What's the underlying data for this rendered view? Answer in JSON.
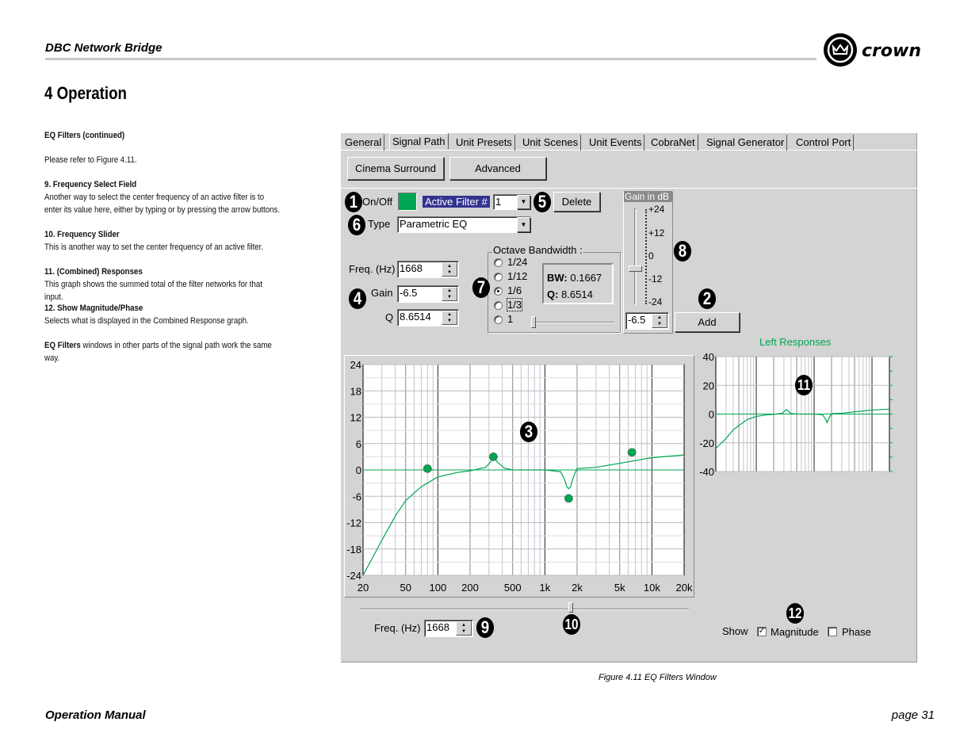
{
  "header": {
    "title": "DBC Network Bridge",
    "logo_text": "crown",
    "section": "4 Operation"
  },
  "body": {
    "heading": "EQ Filters (continued)",
    "refer": "Please refer to Figure 4.11.",
    "items": [
      {
        "title": "9. Frequency Select Field",
        "text": "Another way to select the center frequency of an active filter is to enter its value here, either by typing or by pressing the arrow buttons."
      },
      {
        "title": "10. Frequency Slider",
        "text": "This is another way to set the center frequency of an active filter."
      },
      {
        "title": "11. (Combined) Responses",
        "text": "This graph shows the summed total of the filter networks for that input."
      },
      {
        "title": "12. Show Magnitude/Phase",
        "text": "Selects what is displayed in the Combined Response graph."
      }
    ],
    "closing_bold": "EQ Filters",
    "closing_rest": " windows in other parts of the signal path work the same way."
  },
  "window": {
    "tabs": [
      "General",
      "Signal Path",
      "Unit Presets",
      "Unit Scenes",
      "Unit Events",
      "CobraNet",
      "Signal Generator",
      "Control Port"
    ],
    "selected_tab": "Signal Path",
    "buttons": {
      "cinema": "Cinema Surround",
      "advanced": "Advanced",
      "delete": "Delete",
      "add": "Add"
    },
    "onoff_label": "On/Off",
    "onoff_color": "#00a651",
    "active_filter_label": "Active Filter #",
    "active_filter_value": "1",
    "type_label": "Type",
    "type_value": "Parametric EQ",
    "freq_label": "Freq. (Hz)",
    "freq_value": "1668",
    "gain_label": "Gain",
    "gain_value": "-6.5",
    "q_label": "Q",
    "q_value": "8.6514",
    "octave": {
      "title": "Octave Bandwidth :",
      "options": [
        "1/24",
        "1/12",
        "1/6",
        "1/3",
        "1"
      ],
      "selected": "1/6",
      "bw_label": "BW:",
      "bw_value": "0.1667",
      "q_label": "Q:",
      "q_value": "8.6514"
    },
    "gain_slider": {
      "title": "Gain in dB",
      "ticks": [
        "+24",
        "+12",
        "0",
        "-12",
        "-24"
      ],
      "value": "-6.5"
    },
    "bottom_freq_label": "Freq. (Hz)",
    "bottom_freq_value": "1668",
    "show_label": "Show",
    "magnitude_label": "Magnitude",
    "magnitude_checked": true,
    "phase_label": "Phase",
    "phase_checked": false,
    "callouts": [
      "1",
      "2",
      "3",
      "4",
      "5",
      "6",
      "7",
      "8",
      "9",
      "10",
      "11",
      "12"
    ]
  },
  "chart_data": [
    {
      "type": "line",
      "title": "",
      "xscale": "log",
      "xlim": [
        20,
        20000
      ],
      "ylim": [
        -24,
        24
      ],
      "xticks": [
        "20",
        "50",
        "100",
        "200",
        "500",
        "1k",
        "2k",
        "5k",
        "10k",
        "20k"
      ],
      "xtick_values": [
        20,
        50,
        100,
        200,
        500,
        1000,
        2000,
        5000,
        10000,
        20000
      ],
      "yticks": [
        "24",
        "18",
        "12",
        "6",
        "0",
        "-6",
        "-12",
        "-18",
        "-24"
      ],
      "grid": true,
      "color": "#00a651",
      "series": [
        {
          "x": [
            20,
            30,
            40,
            50,
            70,
            100,
            150,
            200,
            280,
            310,
            330,
            360,
            420,
            500,
            1000,
            1400,
            1520,
            1600,
            1668,
            1740,
            1850,
            2000,
            3000,
            5000,
            10000,
            20000
          ],
          "y": [
            -24,
            -16,
            -10.5,
            -7,
            -3.8,
            -1.6,
            -0.6,
            -0.2,
            0.6,
            1.8,
            3,
            1.8,
            0.4,
            0,
            0,
            -0.4,
            -2,
            -3.8,
            -4.3,
            -3.8,
            -1.5,
            0.3,
            0.6,
            1.5,
            2.8,
            3.4
          ]
        }
      ],
      "markers": [
        {
          "x": 80,
          "y": 0.3
        },
        {
          "x": 330,
          "y": 3
        },
        {
          "x": 1668,
          "y": -6.5
        },
        {
          "x": 6500,
          "y": 4
        }
      ]
    },
    {
      "type": "line",
      "title": "Left Responses",
      "xscale": "log",
      "xlim": [
        20,
        20000
      ],
      "ylim": [
        -40,
        40
      ],
      "yticks": [
        "40",
        "20",
        "0",
        "-20",
        "-40"
      ],
      "grid": true,
      "color": "#00a651",
      "series": [
        {
          "x": [
            20,
            30,
            40,
            50,
            70,
            100,
            150,
            200,
            280,
            330,
            400,
            500,
            1000,
            1400,
            1600,
            1668,
            1800,
            2000,
            3000,
            5000,
            10000,
            20000
          ],
          "y": [
            -24,
            -17,
            -11,
            -8,
            -3.8,
            -1.6,
            -0.6,
            -0.2,
            0.6,
            3,
            0.4,
            0,
            0,
            -0.5,
            -4,
            -6,
            -3,
            0.3,
            0.6,
            1.5,
            2.8,
            3.4
          ]
        }
      ]
    }
  ],
  "caption": "Figure 4.11  EQ Filters Window",
  "footer": {
    "left": "Operation Manual",
    "right": "page 31"
  }
}
